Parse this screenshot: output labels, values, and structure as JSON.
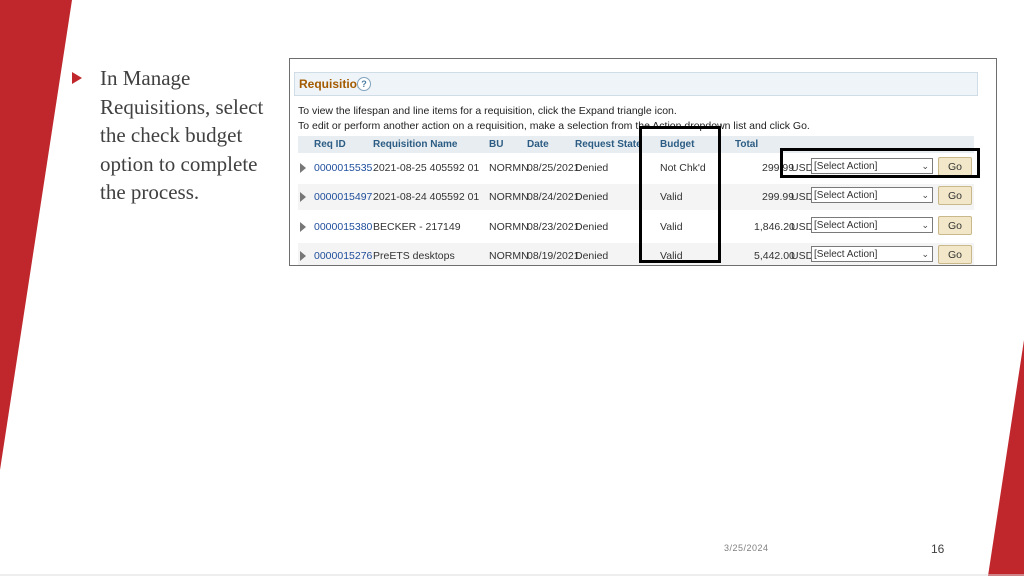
{
  "slide": {
    "bullet_text": "In Manage Requisitions, select the check budget option to complete the process.",
    "date": "3/25/2024",
    "page_number": "16",
    "accent_color": "#c0272d"
  },
  "screenshot": {
    "section_title": "Requisitions",
    "help_icon": "?",
    "instruction_1": "To view the lifespan and line items for a requisition, click the Expand triangle icon.",
    "instruction_2": "To edit or perform another action on a requisition, make a selection from the Action dropdown list and click Go.",
    "columns": {
      "req_id": "Req ID",
      "requisition_name": "Requisition Name",
      "bu": "BU",
      "date": "Date",
      "request_state": "Request State",
      "budget": "Budget",
      "total": "Total"
    },
    "rows": [
      {
        "req_id": "0000015535",
        "name": "2021-08-25 405592 01",
        "bu": "NORMN",
        "date": "08/25/2021",
        "state": "Denied",
        "budget": "Not Chk'd",
        "total": "299.99",
        "currency": "USD",
        "action": "[Select Action]",
        "go": "Go"
      },
      {
        "req_id": "0000015497",
        "name": "2021-08-24 405592 01",
        "bu": "NORMN",
        "date": "08/24/2021",
        "state": "Denied",
        "budget": "Valid",
        "total": "299.99",
        "currency": "USD",
        "action": "[Select Action]",
        "go": "Go"
      },
      {
        "req_id": "0000015380",
        "name": "BECKER - 217149",
        "bu": "NORMN",
        "date": "08/23/2021",
        "state": "Denied",
        "budget": "Valid",
        "total": "1,846.20",
        "currency": "USD",
        "action": "[Select Action]",
        "go": "Go"
      },
      {
        "req_id": "0000015276",
        "name": "PreETS desktops",
        "bu": "NORMN",
        "date": "08/19/2021",
        "state": "Denied",
        "budget": "Valid",
        "total": "5,442.00",
        "currency": "USD",
        "action": "[Select Action]",
        "go": "Go"
      }
    ]
  }
}
